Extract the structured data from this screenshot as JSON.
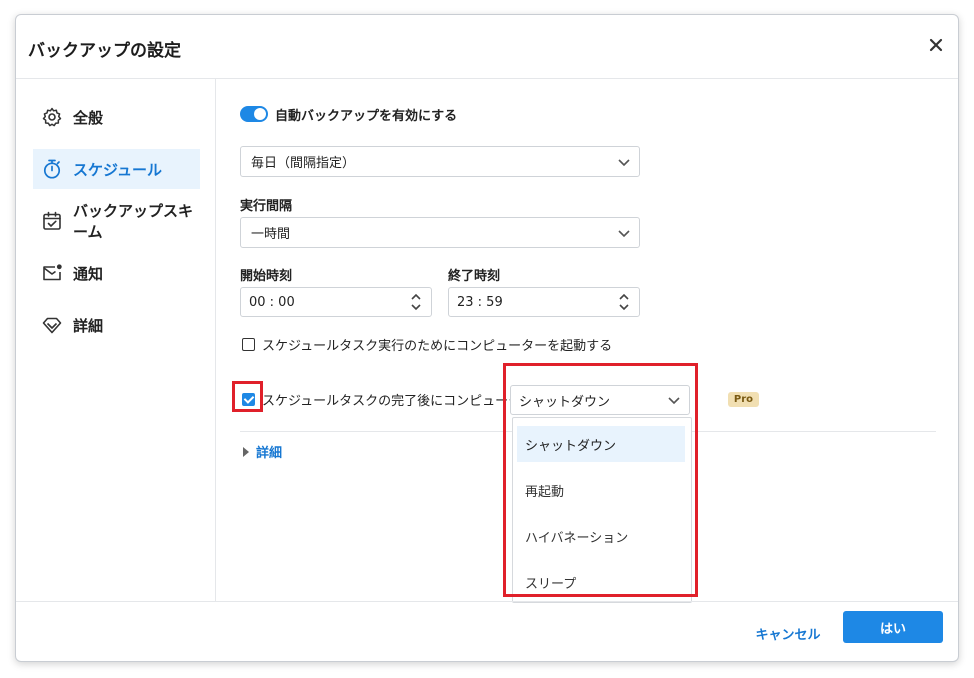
{
  "window": {
    "title": "バックアップの設定"
  },
  "sidebar": {
    "items": [
      {
        "label": "全般",
        "icon": "gear-icon"
      },
      {
        "label": "スケジュール",
        "icon": "timer-icon"
      },
      {
        "label": "バックアップスキーム",
        "icon": "calendar-check-icon"
      },
      {
        "label": "通知",
        "icon": "mail-notification-icon"
      },
      {
        "label": "詳細",
        "icon": "diamond-icon"
      }
    ],
    "active_index": 1
  },
  "schedule": {
    "auto_backup_label": "自動バックアップを有効にする",
    "auto_backup_enabled": true,
    "frequency_value": "毎日（間隔指定）",
    "interval_label": "実行間隔",
    "interval_value": "一時間",
    "start_label": "開始時刻",
    "start_value": "00 : 00",
    "end_label": "終了時刻",
    "end_value": "23 : 59",
    "wake_label": "スケジュールタスク実行のためにコンピューターを起動する",
    "wake_checked": false,
    "after_label": "スケジュールタスクの完了後にコンピューターを",
    "after_checked": true,
    "after_action_value": "シャットダウン",
    "after_action_options": [
      "シャットダウン",
      "再起動",
      "ハイバネーション",
      "スリープ"
    ],
    "pro_badge": "Pro",
    "details_label": "詳細"
  },
  "footer": {
    "cancel_label": "キャンセル",
    "ok_label": "はい"
  },
  "colors": {
    "accent": "#1e88e5",
    "highlight_border": "#e0202a",
    "active_nav_bg": "#e8f3fd"
  }
}
